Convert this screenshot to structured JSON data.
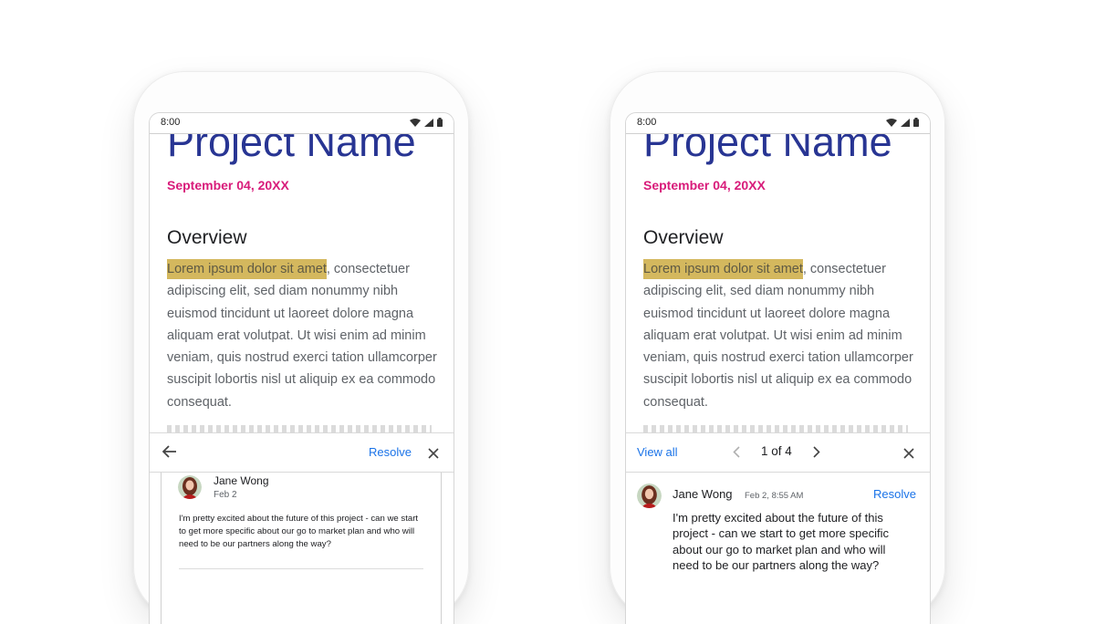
{
  "phones": {
    "left": {
      "status": {
        "time": "8:00",
        "icons": [
          "wifi-icon",
          "signal-icon",
          "battery-icon"
        ]
      },
      "doc": {
        "title": "Project Name",
        "date": "September 04, 20XX",
        "heading": "Overview",
        "highlight": "Lorem ipsum dolor sit amet",
        "body": ", consectetuer adipiscing elit, sed diam nonummy nibh euismod tincidunt ut laoreet dolore magna aliquam erat volutpat. Ut wisi enim ad minim veniam, quis nostrud exerci tation ullamcorper suscipit lobortis nisl ut aliquip ex ea commodo consequat."
      },
      "toolbar": {
        "back_icon": "arrow-back-icon",
        "resolve_label": "Resolve",
        "close_icon": "close-icon"
      },
      "comment": {
        "author": "Jane Wong",
        "date": "Feb 2",
        "text": "I'm pretty excited about the future of this project - can we start to get more specific about our go to market plan and who will need to be our partners along the way?"
      }
    },
    "right": {
      "status": {
        "time": "8:00",
        "icons": [
          "wifi-icon",
          "signal-icon",
          "battery-icon"
        ]
      },
      "doc": {
        "title": "Project Name",
        "date": "September 04, 20XX",
        "heading": "Overview",
        "highlight": "Lorem ipsum dolor sit amet",
        "body": ", consectetuer adipiscing elit, sed diam nonummy nibh euismod tincidunt ut laoreet dolore magna aliquam erat volutpat. Ut wisi enim ad minim veniam, quis nostrud exerci tation ullamcorper suscipit lobortis nisl ut aliquip ex ea commodo consequat."
      },
      "toolbar": {
        "view_all_label": "View all",
        "counter": "1 of 4",
        "prev_icon": "chevron-left-icon",
        "next_icon": "chevron-right-icon",
        "close_icon": "close-icon"
      },
      "comment": {
        "author": "Jane Wong",
        "date": "Feb 2, 8:55 AM",
        "resolve_label": "Resolve",
        "text": "I'm pretty excited about the future of this project - can we start to get more specific about our go to market plan and who will need to be our partners along the way?"
      }
    }
  },
  "colors": {
    "title": "#283593",
    "date": "#d81b7a",
    "highlight": "#d4b85e",
    "link": "#1a73e8",
    "body_text": "#5f6368"
  }
}
